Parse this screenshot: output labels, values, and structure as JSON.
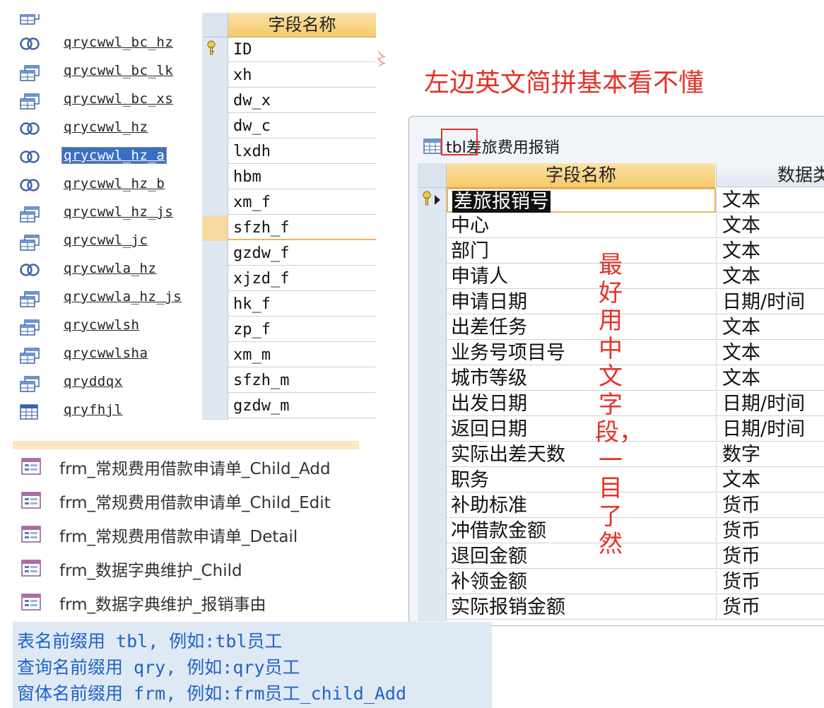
{
  "queries": [
    {
      "label": "qrycwwl_bc_hz",
      "icon": "union-query-icon"
    },
    {
      "label": "qrycwwl_bc_lk",
      "icon": "select-query-icon"
    },
    {
      "label": "qrycwwl_bc_xs",
      "icon": "select-query-icon"
    },
    {
      "label": "qrycwwl_hz",
      "icon": "union-query-icon"
    },
    {
      "label": "qrycwwl_hz_a",
      "icon": "union-query-icon",
      "selected": true
    },
    {
      "label": "qrycwwl_hz_b",
      "icon": "union-query-icon"
    },
    {
      "label": "qrycwwl_hz_js",
      "icon": "select-query-icon"
    },
    {
      "label": "qrycwwl_jc",
      "icon": "select-query-icon"
    },
    {
      "label": "qrycwwla_hz",
      "icon": "union-query-icon"
    },
    {
      "label": "qrycwwla_hz_js",
      "icon": "select-query-icon"
    },
    {
      "label": "qrycwwlsh",
      "icon": "select-query-icon"
    },
    {
      "label": "qrycwwlsha",
      "icon": "select-query-icon"
    },
    {
      "label": "qryddqx",
      "icon": "select-query-icon"
    },
    {
      "label": "qryfhjl",
      "icon": "crosstab-query-icon"
    }
  ],
  "field_grid": {
    "header": "字段名称",
    "rows": [
      "ID",
      "xh",
      "dw_x",
      "dw_c",
      "lxdh",
      "hbm",
      "xm_f",
      "sfzh_f",
      "gzdw_f",
      "xjzd_f",
      "hk_f",
      "zp_f",
      "xm_m",
      "sfzh_m",
      "gzdw_m"
    ],
    "key_row": 0,
    "highlighted_row": 7
  },
  "annotation_top": "左边英文简拼基本看不懂",
  "annotation_vertical": "最好用中文字段，一目了然",
  "table_panel": {
    "title": "tbl差旅费用报销",
    "col1_header": "字段名称",
    "col2_header": "数据类",
    "rows": [
      {
        "name": "差旅报销号",
        "type": "文本"
      },
      {
        "name": "中心",
        "type": "文本"
      },
      {
        "name": "部门",
        "type": "文本"
      },
      {
        "name": "申请人",
        "type": "文本"
      },
      {
        "name": "申请日期",
        "type": "日期/时间"
      },
      {
        "name": "出差任务",
        "type": "文本"
      },
      {
        "name": "业务号项目号",
        "type": "文本"
      },
      {
        "name": "城市等级",
        "type": "文本"
      },
      {
        "name": "出发日期",
        "type": "日期/时间"
      },
      {
        "name": "返回日期",
        "type": "日期/时间"
      },
      {
        "name": "实际出差天数",
        "type": "数字"
      },
      {
        "name": "职务",
        "type": "文本"
      },
      {
        "name": "补助标准",
        "type": "货币"
      },
      {
        "name": "冲借款金额",
        "type": "货币"
      },
      {
        "name": "退回金额",
        "type": "货币"
      },
      {
        "name": "补领金额",
        "type": "货币"
      },
      {
        "name": "实际报销金额",
        "type": "货币"
      }
    ]
  },
  "forms": [
    "frm_常规费用借款申请单_Child_Add",
    "frm_常规费用借款申请单_Child_Edit",
    "frm_常规费用借款申请单_Detail",
    "frm_数据字典维护_Child",
    "frm_数据字典维护_报销事由"
  ],
  "naming_notes": [
    "表名前缀用 tbl, 例如:tbl员工",
    "查询名前缀用 qry, 例如:qry员工",
    "窗体名前缀用 frm, 例如:frm员工_child_Add"
  ],
  "colors": {
    "accent_red": "#e53228",
    "note_blue": "#1f63c9",
    "header_gold": "#f5c96b",
    "selection_blue": "#3a6fc4"
  }
}
